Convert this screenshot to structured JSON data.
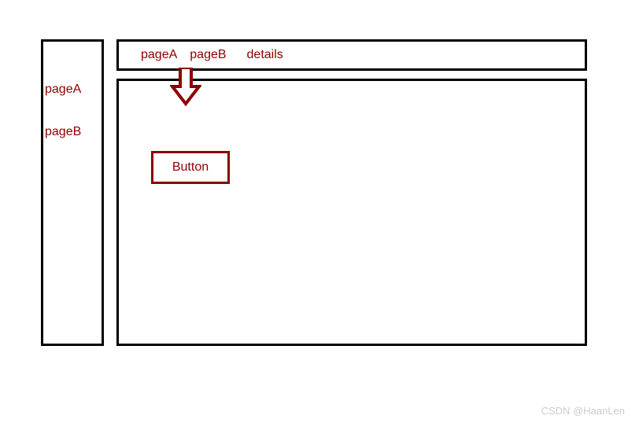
{
  "sidebar": {
    "items": [
      {
        "label": "pageA"
      },
      {
        "label": "pageB"
      }
    ]
  },
  "breadcrumb": {
    "items": [
      {
        "label": "pageA"
      },
      {
        "label": "pageB"
      },
      {
        "label": "details"
      }
    ]
  },
  "content": {
    "button_label": "Button"
  },
  "colors": {
    "accent": "#8b0000",
    "border": "#000000"
  },
  "watermark": "CSDN @HaanLen"
}
